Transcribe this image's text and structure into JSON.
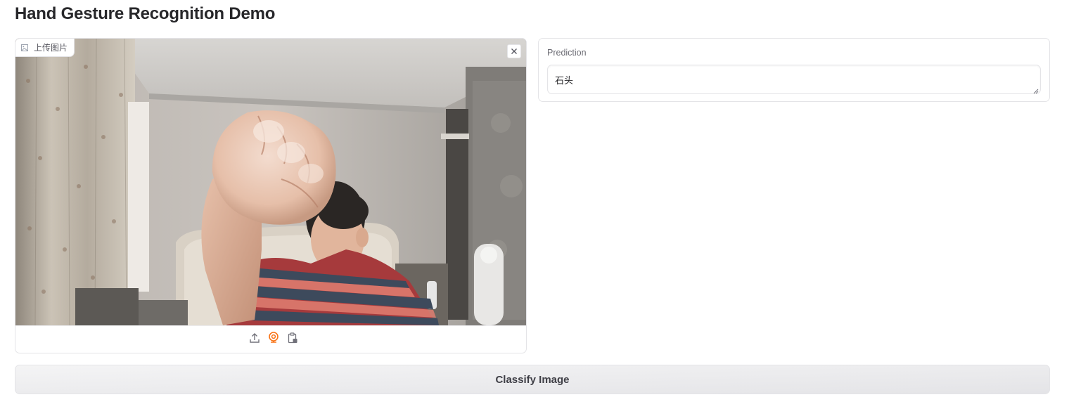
{
  "page": {
    "title": "Hand Gesture Recognition Demo"
  },
  "image_input": {
    "label": "上传图片",
    "label_icon": "image-icon",
    "clear_icon": "close-icon",
    "sources": [
      {
        "name": "upload-source-button",
        "icon": "upload-icon"
      },
      {
        "name": "webcam-source-button",
        "icon": "webcam-icon",
        "active_color": "#f97316"
      },
      {
        "name": "clipboard-source-button",
        "icon": "clipboard-icon"
      }
    ]
  },
  "prediction": {
    "label": "Prediction",
    "value": "石头"
  },
  "actions": {
    "classify_label": "Classify Image"
  },
  "colors": {
    "accent": "#f97316",
    "border": "#e4e4e7",
    "text": "#27272a"
  }
}
